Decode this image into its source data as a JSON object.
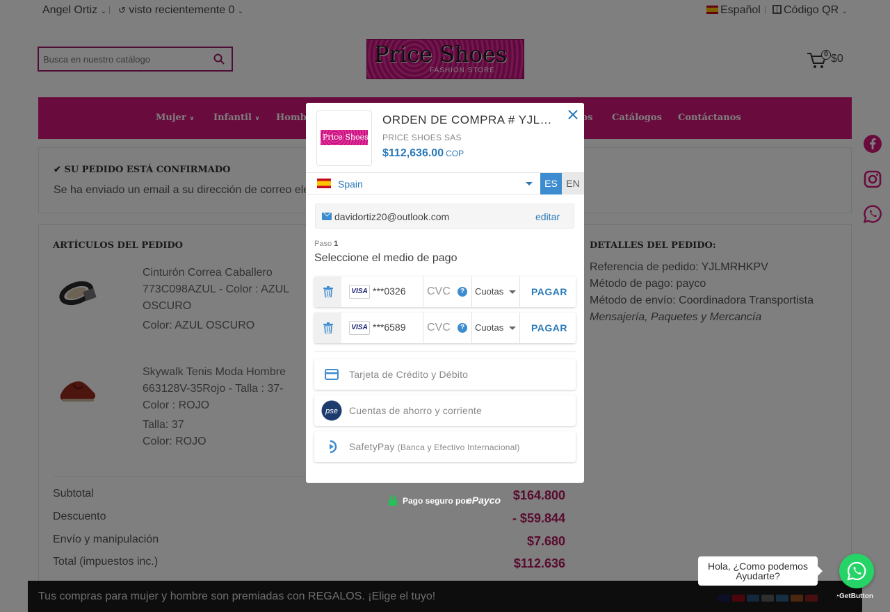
{
  "topbar": {
    "user": "Angel Ortiz",
    "recent": "visto recientemente 0",
    "language": "Español",
    "qr": "Código QR"
  },
  "search": {
    "placeholder": "Busca en nuestro catálogo"
  },
  "logo": {
    "title": "Price Shoes",
    "subtitle": "FASHION STORE"
  },
  "cart": {
    "count": "0",
    "total": "$0"
  },
  "nav": {
    "items": [
      "Mujer",
      "Infantil",
      "Hombre",
      "Zapatos",
      "Catálogos",
      "Contáctanos"
    ]
  },
  "confirmation": {
    "title": "SU PEDIDO ESTÁ CONFIRMADO",
    "text": "Se ha enviado un email a su dirección de correo electrónico"
  },
  "order_items": {
    "title": "ARTÍCULOS DEL PEDIDO",
    "items": [
      {
        "name_line1": "Cinturón Correa Caballero",
        "name_line2": "773C098AZUL - Color : AZUL",
        "name_line3": "OSCURO",
        "attr1": "Color: AZUL OSCURO"
      },
      {
        "name_line1": "Skywalk Tenis Moda Hombre",
        "name_line2": "663128V-35Rojo - Talla : 37-",
        "name_line3": "Color : ROJO",
        "attr1": "Talla: 37",
        "attr2": "Color: ROJO"
      }
    ]
  },
  "order_details": {
    "title": "DETALLES DEL PEDIDO:",
    "reference": "Referencia de pedido: YJLMRHKPV",
    "payment": "Método de pago: payco",
    "shipping": "Método de envío: Coordinadora Transportista",
    "shipping_desc": "Mensajería, Paquetes y Mercancía"
  },
  "totals": {
    "subtotal_label": "Subtotal",
    "subtotal": "$164.800",
    "discount_label": "Descuento",
    "discount": "- $59.844",
    "shipping_label": "Envío y manipulación",
    "shipping": "$7.680",
    "total_label": "Total (impuestos inc.)",
    "total": "$112.636"
  },
  "footer": {
    "promo": "Tus compras para mujer y hombre son premiadas con REGALOS. ¡Elige el tuyo!"
  },
  "modal": {
    "logo_text": "Price Shoes",
    "order_title": "ORDEN DE COMPRA # YJLMRHKPV",
    "company": "PRICE SHOES SAS",
    "amount": "$112,636.00",
    "currency": "COP",
    "country": "Spain",
    "lang_es": "ES",
    "lang_en": "EN",
    "email": "davidortiz20@outlook.com",
    "edit": "editar",
    "step_label": "Paso",
    "step_number": "1",
    "step_title": "Seleccione el medio de pago",
    "cards": [
      {
        "brand": "VISA",
        "number": "***0326",
        "cvc": "CVC",
        "installments": "Cuotas",
        "pay": "PAGAR"
      },
      {
        "brand": "VISA",
        "number": "***6589",
        "cvc": "CVC",
        "installments": "Cuotas",
        "pay": "PAGAR"
      }
    ],
    "methods": [
      {
        "label": "Tarjeta de Crédito y Débito",
        "icon": "credit-card-icon"
      },
      {
        "label": "Cuentas de ahorro y corriente",
        "icon": "pse-icon",
        "icon_text": "pse"
      },
      {
        "label": "SafetyPay",
        "sub": "(Banca y Efectivo Internacional)",
        "icon": "safetypay-icon"
      }
    ]
  },
  "secure": {
    "text": "Pago seguro por",
    "brand": "ePayco"
  },
  "whatsapp": {
    "bubble_line1": "Hola, ¿Como podemos",
    "bubble_line2": "Ayudarte?",
    "brand": "GetButton"
  },
  "colors": {
    "brand_pink": "#d5177a",
    "accent_blue": "#2a7ab8",
    "price_red": "#b0175f",
    "whatsapp_green": "#25d366"
  }
}
